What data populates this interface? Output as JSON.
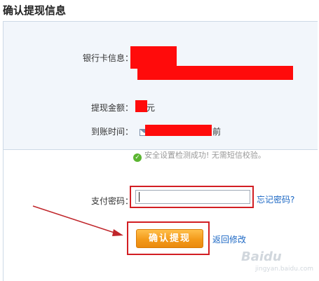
{
  "header": {
    "title": "确认提现信息"
  },
  "info": {
    "bank_card_label": "银行卡信息：",
    "amount_label": "提现金额：",
    "amount_unit": "元",
    "arrival_label": "到账时间：",
    "arrival_suffix": "前"
  },
  "verify": {
    "success_text": "安全设置检测成功! 无需短信校验。",
    "password_label": "支付密码：",
    "password_value": "",
    "forgot_password_link": "忘记密码?"
  },
  "actions": {
    "confirm_button": "确认提现",
    "back_link": "返回修改"
  },
  "watermark": {
    "text": "Baidu",
    "sub": "jingyan.baidu.com"
  },
  "colors": {
    "redaction": "#ff0b0b",
    "highlight_outline": "#d21e23",
    "button_orange": "#f39a1a",
    "link_blue": "#1b67c4",
    "success_green": "#5bb531",
    "info_background": "#f2f6fb"
  },
  "icons": [
    "check-circle-icon",
    "mail-icon",
    "annotation-arrow"
  ]
}
